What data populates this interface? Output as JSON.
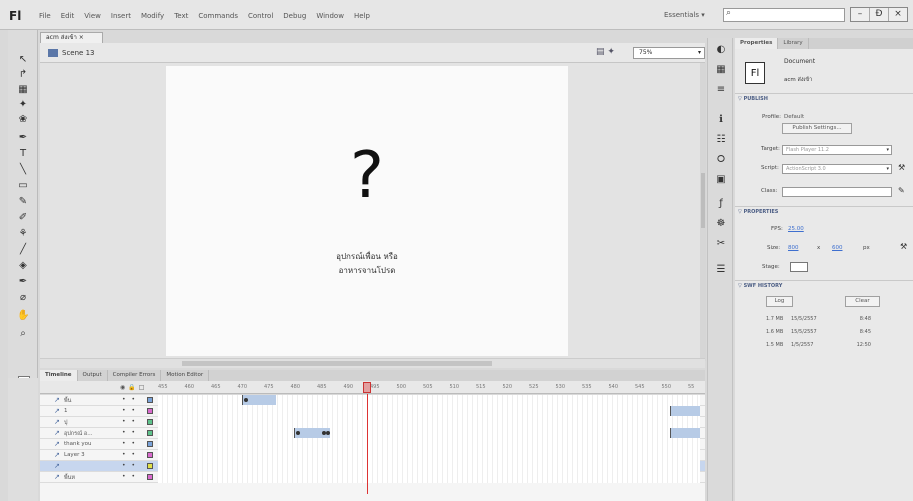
{
  "app": {
    "logo": "Fl",
    "menu": [
      "File",
      "Edit",
      "View",
      "Insert",
      "Modify",
      "Text",
      "Commands",
      "Control",
      "Debug",
      "Window",
      "Help"
    ],
    "workspace": "Essentials ▾",
    "search_placeholder": "",
    "window_controls": [
      "–",
      "Ɖ",
      "×"
    ]
  },
  "document": {
    "tab_label": "acm ส่งเข้า ×",
    "scene": "Scene 13",
    "zoom": "75%"
  },
  "stage": {
    "glyph": "?",
    "line1": "อุปกรณ์เพื่อน หรือ",
    "line2": "อาหารจานโปรด",
    "background": "#fafafa"
  },
  "timeline": {
    "tabs": [
      "Timeline",
      "Output",
      "Compiler Errors",
      "Motion Editor"
    ],
    "frame_numbers": [
      "455",
      "460",
      "465",
      "470",
      "475",
      "480",
      "485",
      "490",
      "495",
      "500",
      "505",
      "510",
      "515",
      "520",
      "525",
      "530",
      "535",
      "540",
      "545",
      "550",
      "55"
    ],
    "current_frame": 493,
    "layers": [
      {
        "name": "พื้น",
        "color": "#7aa3d9"
      },
      {
        "name": "1",
        "color": "#d96acd"
      },
      {
        "name": "ปุ",
        "color": "#5ec28b"
      },
      {
        "name": "อุปกรณ์ อ...",
        "color": "#5ec28b"
      },
      {
        "name": "thank you",
        "color": "#7aa3d9"
      },
      {
        "name": "Layer 3",
        "color": "#d96acd"
      },
      {
        "name": "",
        "color": "#e0e04a"
      },
      {
        "name": "พื้นห",
        "color": "#d96acd"
      }
    ]
  },
  "properties": {
    "tabs": [
      "Properties",
      "Library"
    ],
    "kind": "Document",
    "doc_name": "acm ส่งเข้า",
    "badge": "Fl",
    "publish": {
      "header": "▽ PUBLISH",
      "profile_label": "Profile:",
      "profile_value": "Default",
      "settings_button": "Publish Settings...",
      "target_label": "Target:",
      "target_value": "Flash Player 11.2",
      "script_label": "Script:",
      "script_value": "ActionScript 3.0",
      "class_label": "Class:"
    },
    "props": {
      "header": "▽ PROPERTIES",
      "fps_label": "FPS:",
      "fps_value": "25.00",
      "size_label": "Size:",
      "width": "800",
      "x": "x",
      "height": "600",
      "unit": "px",
      "stage_label": "Stage:"
    },
    "history": {
      "header": "▽ SWF HISTORY",
      "log_button": "Log",
      "clear_button": "Clear",
      "rows": [
        {
          "size": "1.7 MB",
          "date": "15/5/2557",
          "time": "8:48"
        },
        {
          "size": "1.6 MB",
          "date": "15/5/2557",
          "time": "8:45"
        },
        {
          "size": "1.5 MB",
          "date": "1/5/2557",
          "time": "12:50"
        }
      ]
    }
  }
}
